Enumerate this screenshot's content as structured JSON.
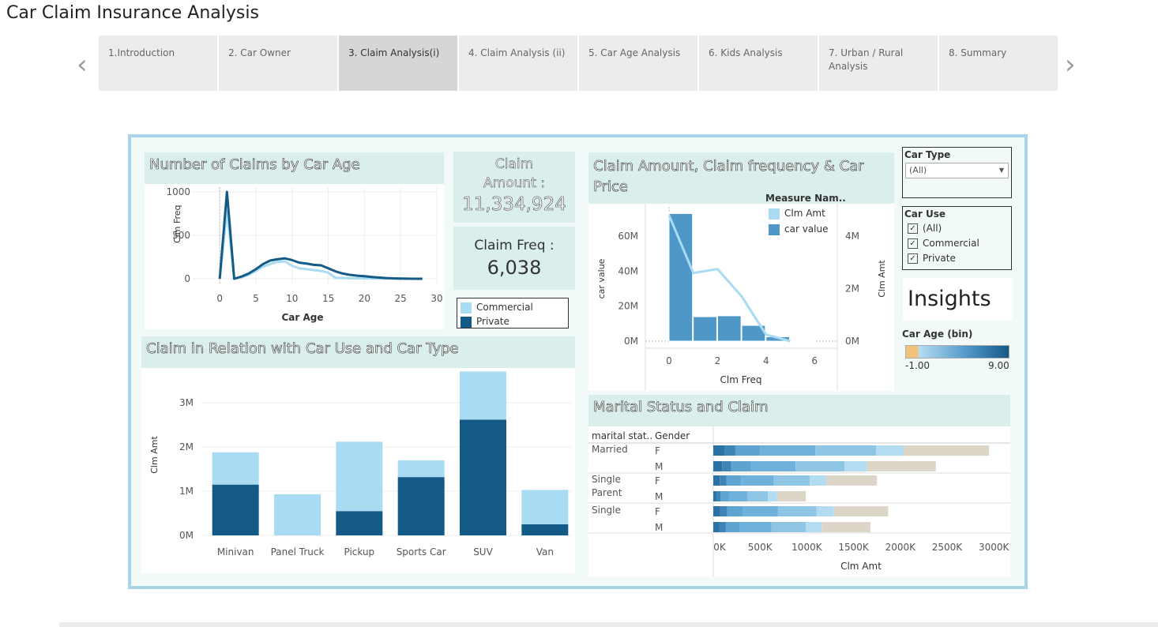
{
  "page_title": "Car Claim Insurance Analysis",
  "tabs": [
    {
      "label": "1.Introduction"
    },
    {
      "label": "2. Car Owner"
    },
    {
      "label": "3. Claim Analysis(i)"
    },
    {
      "label": "4. Claim Analysis (ii)"
    },
    {
      "label": "5. Car  Age Analysis"
    },
    {
      "label": "6. Kids Analysis"
    },
    {
      "label": "7. Urban / Rural Analysis"
    },
    {
      "label": "8. Summary"
    }
  ],
  "nav": {
    "prev_icon": "chevron-left-icon",
    "next_icon": "chevron-right-icon"
  },
  "colors": {
    "commercial": "#a9dcf2",
    "private": "#145a87",
    "panel_bg": "#daeeec",
    "frame": "#a9d3e8",
    "insight_tan": "#dcd6c8"
  },
  "claims_by_age": {
    "title": "Number of Claims by Car Age",
    "chart_data": {
      "type": "line",
      "xlabel": "Car Age",
      "ylabel": "Clm Freq",
      "xlim": [
        -1,
        30
      ],
      "ylim": [
        0,
        1000
      ],
      "x_ticks": [
        "0",
        "5",
        "10",
        "15",
        "20",
        "25",
        "30"
      ],
      "y_ticks": [
        "0",
        "500",
        "1000"
      ],
      "series": [
        {
          "name": "Commercial",
          "x": [
            0,
            1,
            2,
            3,
            4,
            5,
            6,
            7,
            8,
            9,
            10,
            11,
            12,
            13,
            14,
            15,
            16,
            17,
            18,
            19,
            20,
            21,
            22,
            23,
            24,
            25,
            26,
            27,
            28
          ],
          "values": [
            0,
            780,
            0,
            15,
            45,
            90,
            140,
            170,
            195,
            200,
            150,
            120,
            110,
            100,
            90,
            70,
            10,
            8,
            6,
            5,
            4,
            3,
            2,
            2,
            1,
            1,
            0,
            0,
            0
          ]
        },
        {
          "name": "Private",
          "x": [
            0,
            1,
            2,
            3,
            4,
            5,
            6,
            7,
            8,
            9,
            10,
            11,
            12,
            13,
            14,
            15,
            16,
            17,
            18,
            19,
            20,
            21,
            22,
            23,
            24,
            25,
            26,
            27,
            28
          ],
          "values": [
            0,
            1000,
            0,
            25,
            60,
            110,
            170,
            210,
            225,
            235,
            215,
            185,
            175,
            160,
            155,
            120,
            85,
            60,
            45,
            35,
            30,
            20,
            14,
            8,
            4,
            2,
            1,
            0,
            0
          ]
        }
      ]
    }
  },
  "kpi": {
    "claim_amount_label": "Claim Amount :",
    "claim_amount_value": "11,334,924",
    "claim_freq_label": "Claim Freq :",
    "claim_freq_value": "6,038"
  },
  "car_use_legend": {
    "items": [
      {
        "label": "Commercial"
      },
      {
        "label": "Private"
      }
    ]
  },
  "car_type_chart": {
    "title": "Claim in Relation with Car Use and Car Type",
    "chart_data": {
      "type": "bar",
      "stacked": true,
      "categories": [
        "Minivan",
        "Panel Truck",
        "Pickup",
        "Sports Car",
        "SUV",
        "Van"
      ],
      "ylabel": "Clm Amt",
      "ylim": [
        0,
        3700000
      ],
      "y_ticks": [
        "0M",
        "1M",
        "2M",
        "3M"
      ],
      "series": [
        {
          "name": "Private",
          "values": [
            1150000,
            0,
            550000,
            1320000,
            2620000,
            250000
          ]
        },
        {
          "name": "Commercial",
          "values": [
            730000,
            930000,
            1570000,
            380000,
            1090000,
            780000
          ]
        }
      ]
    }
  },
  "price_chart": {
    "title": "Claim Amount, Claim frequency & Car Price",
    "legend_title": "Measure Nam..",
    "legend": [
      {
        "label": "Clm Amt"
      },
      {
        "label": "car value"
      }
    ],
    "chart_data": {
      "type": "bar",
      "xlabel": "Clm Freq",
      "ylabel_left": "car value",
      "ylabel_right": "Clm Amt",
      "x_ticks": [
        "0",
        "2",
        "4",
        "6"
      ],
      "y_ticks_left": [
        "0M",
        "20M",
        "40M",
        "60M"
      ],
      "y_ticks_right": [
        "0M",
        "2M",
        "4M"
      ],
      "ylim_left": [
        0,
        75000000
      ],
      "ylim_right": [
        0,
        5000000
      ],
      "bars": {
        "name": "car value",
        "x": [
          0,
          1,
          2,
          3,
          4,
          5
        ],
        "values": [
          73000000,
          14000000,
          14500000,
          9000000,
          2500000,
          300000
        ]
      },
      "line": {
        "name": "Clm Amt",
        "x": [
          0,
          1,
          2,
          3,
          4,
          5
        ],
        "values": [
          4800000,
          2600000,
          2750000,
          1700000,
          250000,
          0
        ]
      }
    }
  },
  "filters": {
    "car_type_label": "Car Type",
    "car_type_value": "(All)",
    "car_use_label": "Car Use",
    "car_use_options": [
      {
        "label": "(All)"
      },
      {
        "label": "Commercial"
      },
      {
        "label": "Private"
      }
    ]
  },
  "insights": {
    "label": "Insights"
  },
  "car_age_bin": {
    "label": "Car Age (bin)",
    "min": "-1.00",
    "max": "9.00"
  },
  "marital_chart": {
    "title": "Marital Status and Claim",
    "col_headers": [
      "marital stat..",
      "Gender"
    ],
    "xlabel": "Clm Amt",
    "chart_data": {
      "type": "bar",
      "stacked": true,
      "x_ticks": [
        "0K",
        "500K",
        "1000K",
        "1500K",
        "2000K",
        "2500K",
        "3000K"
      ],
      "xlim": [
        0,
        3100000
      ],
      "rows": [
        {
          "status": "Married",
          "gender": "F",
          "total": 2950000
        },
        {
          "status": "",
          "gender": "M",
          "total": 2380000
        },
        {
          "status": "Single Parent",
          "gender": "F",
          "total": 1750000
        },
        {
          "status": "",
          "gender": "M",
          "total": 990000
        },
        {
          "status": "Single",
          "gender": "F",
          "total": 1870000
        },
        {
          "status": "",
          "gender": "M",
          "total": 1680000
        }
      ]
    }
  }
}
